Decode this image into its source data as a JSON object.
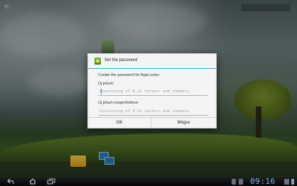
{
  "dialog": {
    "title": "Set the password",
    "description": "Create the password for AppLocker.",
    "new_password_label": "Új jelszó:",
    "new_password_placeholder": "Consisting of 4-12 letters and numbers.",
    "confirm_password_label": "Új jelszó megerősítése:",
    "confirm_password_placeholder": "Consisting of 4-12 letters and numbers.",
    "ok_label": "OK",
    "cancel_label": "Mégse"
  },
  "status_bar": {
    "time": "09:16"
  },
  "colors": {
    "accent": "#33a6d8",
    "clock": "#7fb0e0"
  },
  "icons": {
    "nav_back": "back-arrow-icon",
    "nav_home": "home-icon",
    "nav_recent": "recent-apps-icon",
    "dialog_app": "applocker-icon"
  }
}
